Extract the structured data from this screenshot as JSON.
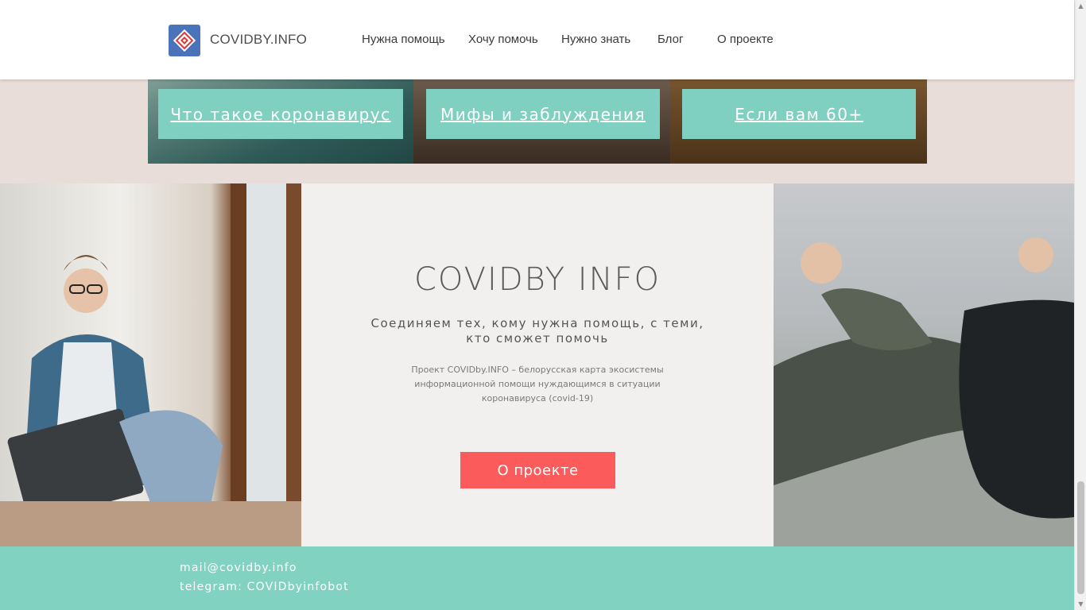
{
  "header": {
    "brand": "COVIDBY.INFO",
    "nav": [
      {
        "label": "Нужна помощь"
      },
      {
        "label": "Хочу помочь"
      },
      {
        "label": "Нужно знать"
      },
      {
        "label": "Блог"
      },
      {
        "label": "О проекте"
      }
    ]
  },
  "cards": [
    {
      "label": "Что такое коронавирус"
    },
    {
      "label": "Мифы и заблуждения"
    },
    {
      "label": "Если вам 60+"
    }
  ],
  "hero": {
    "title": "COVIDBY  INFO",
    "subtitle": "Соединяем тех, кому нужна помощь, с теми, кто сможет помочь",
    "description": "Проект COVIDby.INFO – белорусская карта экосистемы информационной помощи нуждающимся в ситуации коронавируса (covid-19)",
    "button_label": "О проекте"
  },
  "footer": {
    "email": "mail@covidby.info",
    "telegram": "telegram: COVIDbyinfobot"
  },
  "colors": {
    "accent_teal": "#82d2c2",
    "card_button": "#7fd0c0",
    "cta_red": "#fc5b5c",
    "logo_blue": "#4a73b9",
    "page_bg": "#e9ddda"
  },
  "icons": {
    "logo": "ornament-logo-icon"
  }
}
